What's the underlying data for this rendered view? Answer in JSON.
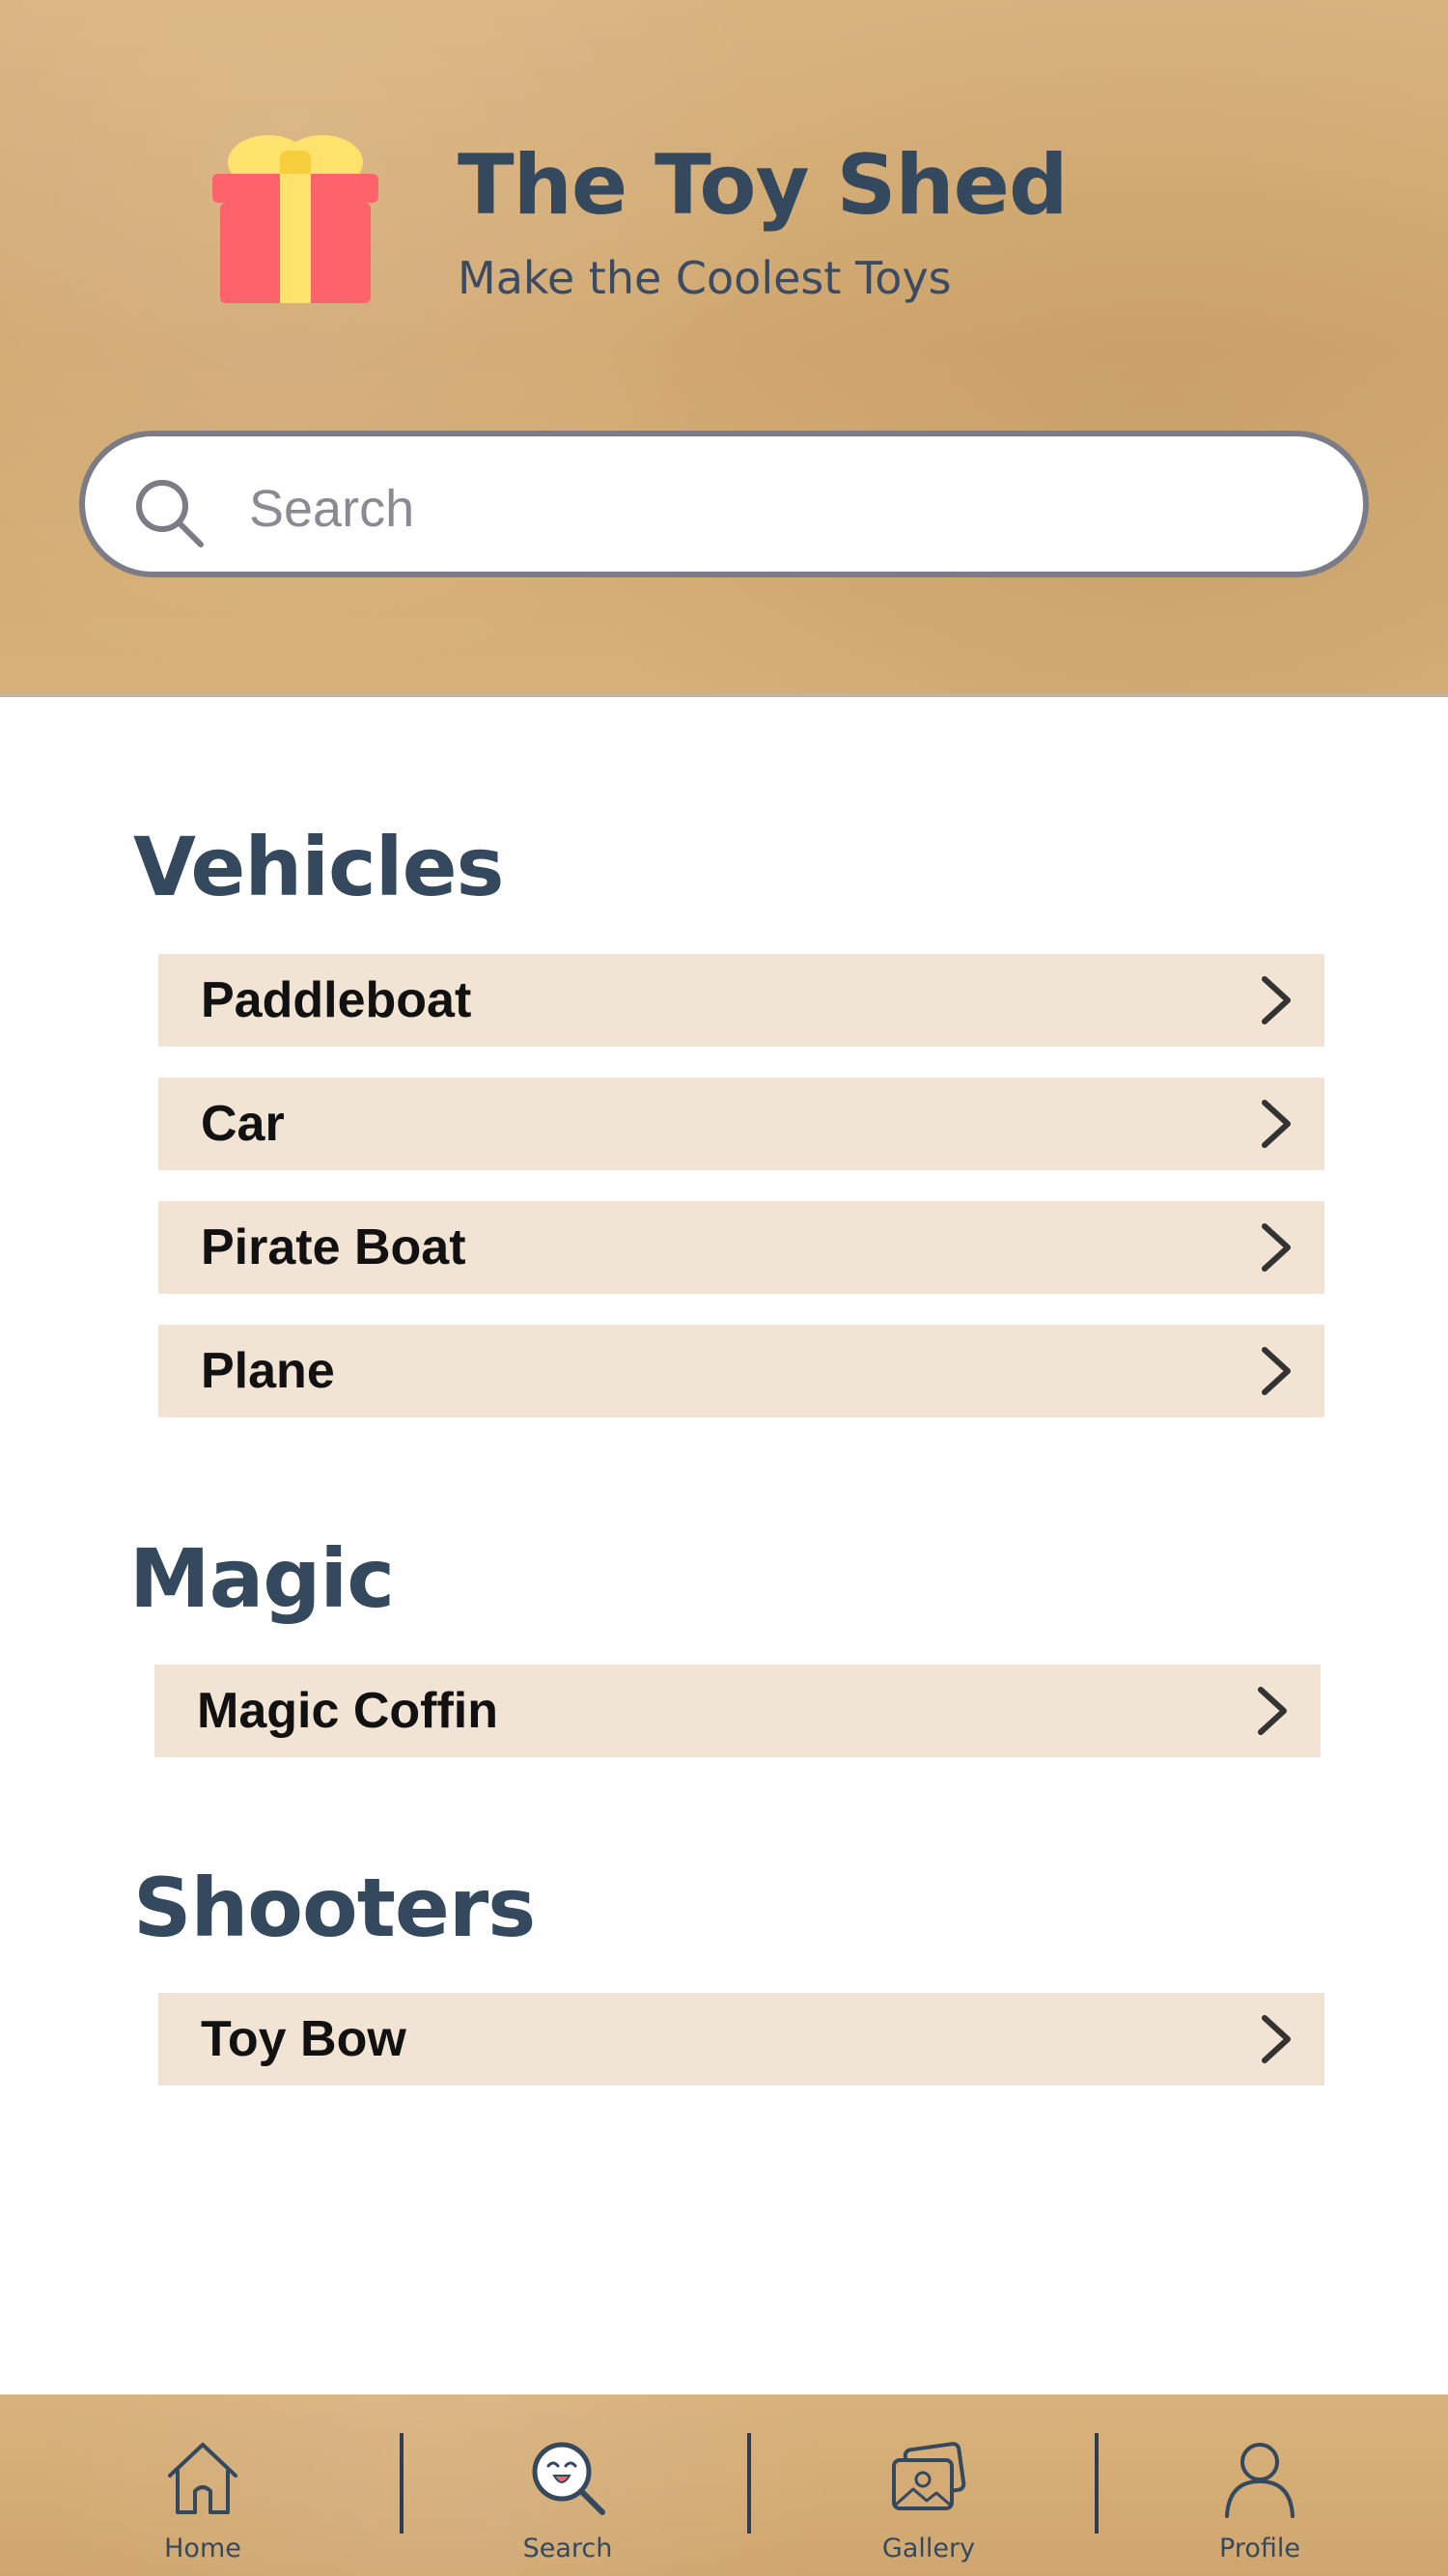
{
  "header": {
    "title": "The Toy Shed",
    "subtitle": "Make the Coolest Toys",
    "logo_icon": "gift-icon"
  },
  "search": {
    "placeholder": "Search",
    "value": ""
  },
  "sections": [
    {
      "title": "Vehicles",
      "items": [
        "Paddleboat",
        "Car",
        "Pirate Boat",
        "Plane"
      ]
    },
    {
      "title": "Magic",
      "items": [
        "Magic Coffin"
      ]
    },
    {
      "title": "Shooters",
      "items": [
        "Toy Bow"
      ]
    }
  ],
  "nav": [
    {
      "label": "Home",
      "icon": "home-icon"
    },
    {
      "label": "Search",
      "icon": "search-face-icon"
    },
    {
      "label": "Gallery",
      "icon": "gallery-icon"
    },
    {
      "label": "Profile",
      "icon": "profile-icon"
    }
  ],
  "colors": {
    "heading": "#34495e",
    "item_background": "#f1e4d4",
    "header_background": "#d4ab74",
    "gift_box": "#fc636b",
    "gift_ribbon": "#fde36b"
  }
}
